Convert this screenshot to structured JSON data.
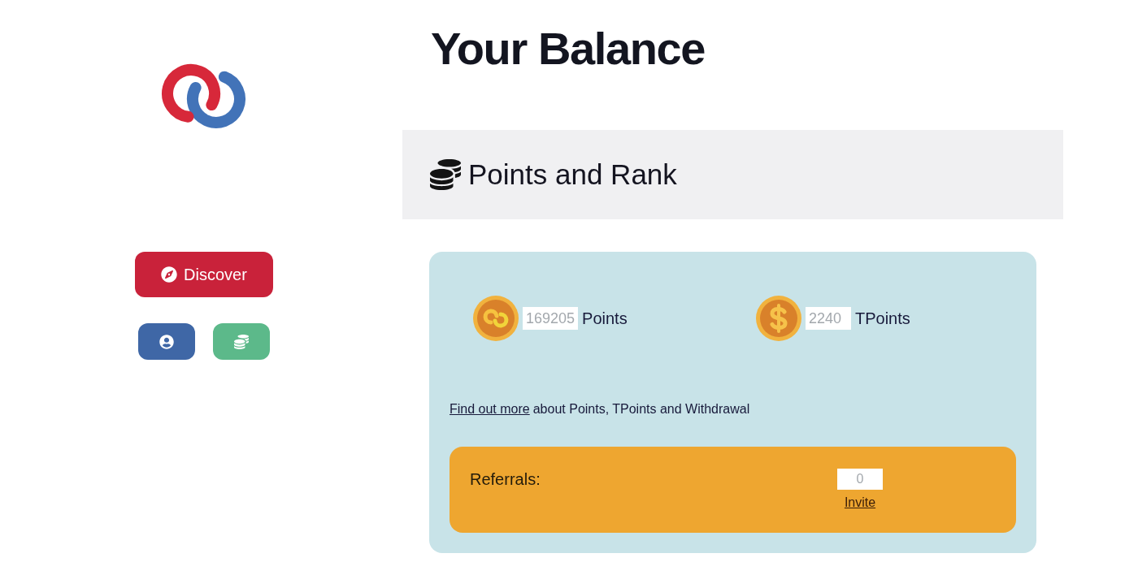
{
  "sidebar": {
    "nav_buttons": [
      {
        "kind": "discover",
        "label": "Discover"
      },
      {
        "kind": "profile"
      },
      {
        "kind": "balance"
      }
    ]
  },
  "page_title": "Your Balance",
  "section": {
    "title": "Points and Rank"
  },
  "balances": [
    {
      "kind": "points",
      "value": "169205",
      "unit": "Points"
    },
    {
      "kind": "tpoints",
      "value": "2240",
      "unit": "TPoints"
    }
  ],
  "info": {
    "link": "Find out more",
    "text": "about Points, TPoints and Withdrawal"
  },
  "referrals": {
    "label": "Referrals:",
    "value": "0",
    "link": "Invite"
  }
}
